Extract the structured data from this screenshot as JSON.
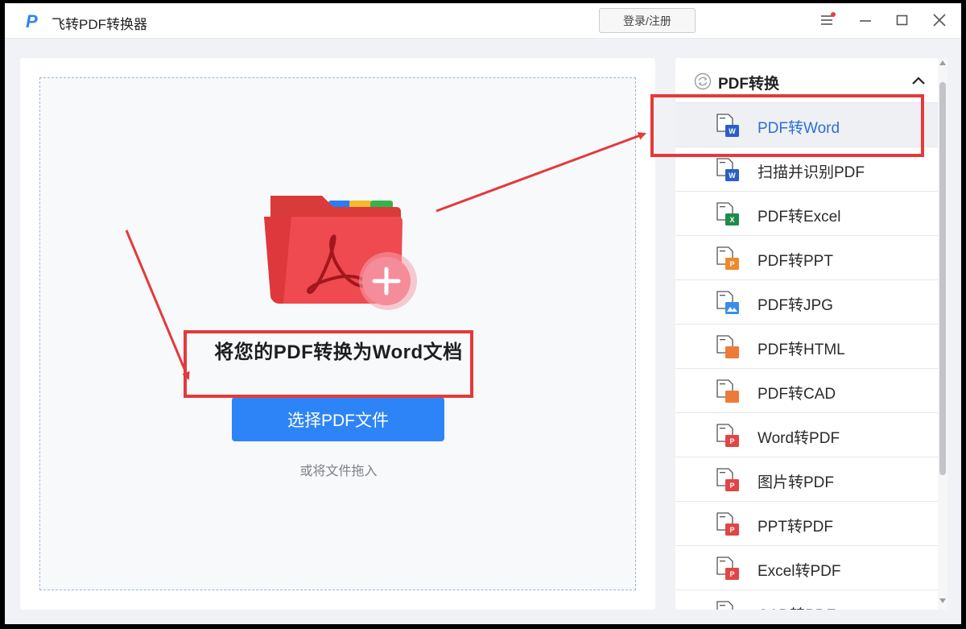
{
  "app": {
    "title": "飞转PDF转换器",
    "logo_letter": "P",
    "brand_color": "#2d84f6"
  },
  "titlebar": {
    "login_label": "登录/注册",
    "icons": [
      "menu-icon",
      "minimize-icon",
      "maximize-icon",
      "close-icon"
    ],
    "notification_dot_color": "#e8413a"
  },
  "main": {
    "heading": "将您的PDF转换为Word文档",
    "select_button_label": "选择PDF文件",
    "drag_hint": "或将文件拖入"
  },
  "sidebar": {
    "section_title": "PDF转换",
    "section_expanded": true,
    "items": [
      {
        "label": "PDF转Word",
        "icon": "pdf-to-word-icon",
        "badge": "W",
        "badge_color": "#2b5fc7",
        "active": true
      },
      {
        "label": "扫描并识别PDF",
        "icon": "scan-ocr-icon",
        "badge": "W",
        "badge_color": "#2b5fc7",
        "active": false
      },
      {
        "label": "PDF转Excel",
        "icon": "pdf-to-excel-icon",
        "badge": "X",
        "badge_color": "#1f8b4c",
        "active": false
      },
      {
        "label": "PDF转PPT",
        "icon": "pdf-to-ppt-icon",
        "badge": "P",
        "badge_color": "#ee8a2c",
        "active": false
      },
      {
        "label": "PDF转JPG",
        "icon": "pdf-to-jpg-icon",
        "badge": "img",
        "badge_color": "#3a8ee8",
        "active": false
      },
      {
        "label": "PDF转HTML",
        "icon": "pdf-to-html-icon",
        "badge": "</>",
        "badge_color": "#ee7a3a",
        "active": false
      },
      {
        "label": "PDF转CAD",
        "icon": "pdf-to-cad-icon",
        "badge": "</>",
        "badge_color": "#ee7a3a",
        "active": false
      },
      {
        "label": "Word转PDF",
        "icon": "word-to-pdf-icon",
        "badge": "P",
        "badge_color": "#e24545",
        "active": false
      },
      {
        "label": "图片转PDF",
        "icon": "image-to-pdf-icon",
        "badge": "P",
        "badge_color": "#e24545",
        "active": false
      },
      {
        "label": "PPT转PDF",
        "icon": "ppt-to-pdf-icon",
        "badge": "P",
        "badge_color": "#e24545",
        "active": false
      },
      {
        "label": "Excel转PDF",
        "icon": "excel-to-pdf-icon",
        "badge": "P",
        "badge_color": "#e24545",
        "active": false
      },
      {
        "label": "CAD转PDF",
        "icon": "cad-to-pdf-icon",
        "badge": "P",
        "badge_color": "#e24545",
        "active": false
      }
    ]
  },
  "annotations": {
    "highlight_color": "#e5393a"
  }
}
